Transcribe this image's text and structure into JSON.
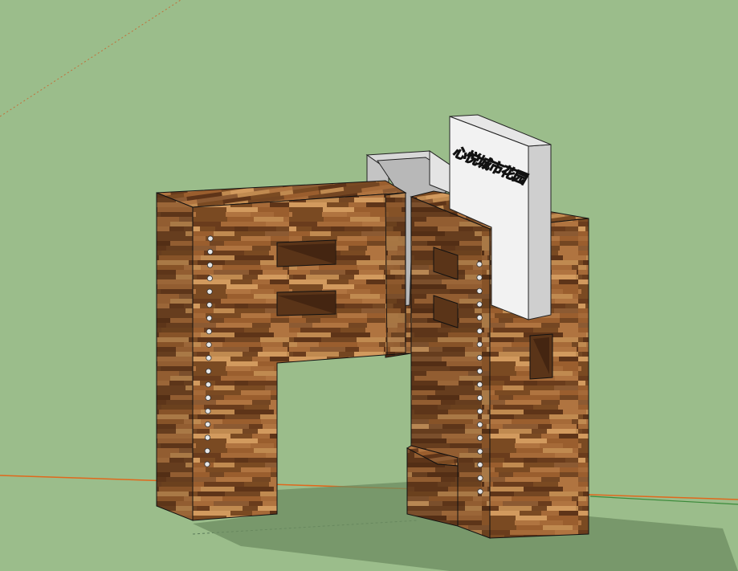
{
  "viewport": {
    "background": "#9bbd8b",
    "axis_colors": {
      "red": "#e0681c",
      "green": "#3a8a3a"
    }
  },
  "model": {
    "wood_colors": [
      "#7a4a22",
      "#9a5e2e",
      "#b07440",
      "#6a3c1c",
      "#c08a50",
      "#8c5a32",
      "#5e3418",
      "#a66a38",
      "#d29a5e",
      "#744622"
    ],
    "sign": {
      "text": "心悦城市花园",
      "face_color": "#f2f2f2",
      "side_color": "#cfcfcf"
    },
    "holes_color": "#e8e8e8"
  }
}
